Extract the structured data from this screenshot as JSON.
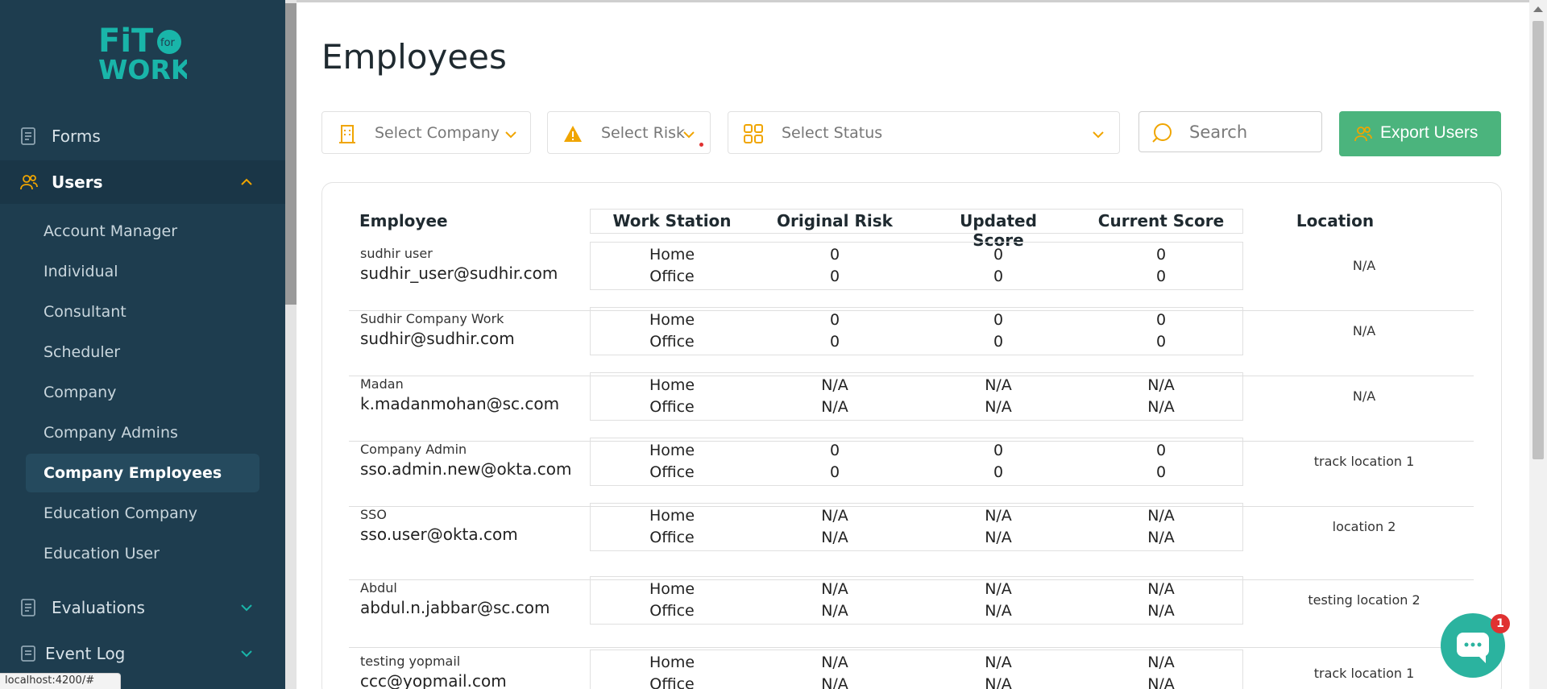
{
  "logo": {
    "text_fit": "FiT",
    "text_for": "for",
    "text_work": "WORK",
    "color": "#19b5a9"
  },
  "sidebar": {
    "forms_label": "Forms",
    "users_label": "Users",
    "sub_items": [
      "Account Manager",
      "Individual",
      "Consultant",
      "Scheduler",
      "Company",
      "Company Admins",
      "Company Employees",
      "Education Company",
      "Education User"
    ],
    "active_item": "Company Employees",
    "evaluations_label": "Evaluations",
    "event_log_label": "Event Log",
    "accent_color": "#f0a500"
  },
  "status_url": "localhost:4200/#",
  "page_title": "Employees",
  "filters": {
    "company_placeholder": "Select Company",
    "risk_placeholder": "Select Risk",
    "status_placeholder": "Select Status"
  },
  "search": {
    "placeholder": "Search"
  },
  "export_button": "Export Users",
  "table": {
    "headers": {
      "employee": "Employee",
      "work_station": "Work Station",
      "original_risk": "Original Risk",
      "updated_score": "Updated Score",
      "current_score": "Current Score",
      "location": "Location"
    },
    "rows": [
      {
        "name": "sudhir user",
        "email": "sudhir_user@sudhir.com",
        "ws1": "Home",
        "ws2": "Office",
        "or1": "0",
        "or2": "0",
        "us1": "0",
        "us2": "0",
        "cs1": "0",
        "cs2": "0",
        "location": "N/A"
      },
      {
        "name": "Sudhir Company Work",
        "email": "sudhir@sudhir.com",
        "ws1": "Home",
        "ws2": "Office",
        "or1": "0",
        "or2": "0",
        "us1": "0",
        "us2": "0",
        "cs1": "0",
        "cs2": "0",
        "location": "N/A"
      },
      {
        "name": "Madan",
        "email": "k.madanmohan@sc.com",
        "ws1": "Home",
        "ws2": "Office",
        "or1": "N/A",
        "or2": "N/A",
        "us1": "N/A",
        "us2": "N/A",
        "cs1": "N/A",
        "cs2": "N/A",
        "location": "N/A"
      },
      {
        "name": "Company Admin",
        "email": "sso.admin.new@okta.com",
        "ws1": "Home",
        "ws2": "Office",
        "or1": "0",
        "or2": "0",
        "us1": "0",
        "us2": "0",
        "cs1": "0",
        "cs2": "0",
        "location": "track location 1"
      },
      {
        "name": "SSO",
        "email": "sso.user@okta.com",
        "ws1": "Home",
        "ws2": "Office",
        "or1": "N/A",
        "or2": "N/A",
        "us1": "N/A",
        "us2": "N/A",
        "cs1": "N/A",
        "cs2": "N/A",
        "location": "location 2"
      },
      {
        "name": "Abdul",
        "email": "abdul.n.jabbar@sc.com",
        "ws1": "Home",
        "ws2": "Office",
        "or1": "N/A",
        "or2": "N/A",
        "us1": "N/A",
        "us2": "N/A",
        "cs1": "N/A",
        "cs2": "N/A",
        "location": "testing location 2"
      },
      {
        "name": "testing yopmail",
        "email": "ccc@yopmail.com",
        "ws1": "Home",
        "ws2": "Office",
        "or1": "N/A",
        "or2": "N/A",
        "us1": "N/A",
        "us2": "N/A",
        "cs1": "N/A",
        "cs2": "N/A",
        "location": "track location 1"
      }
    ]
  },
  "chat": {
    "badge_count": "1",
    "color": "#2bb39f"
  }
}
